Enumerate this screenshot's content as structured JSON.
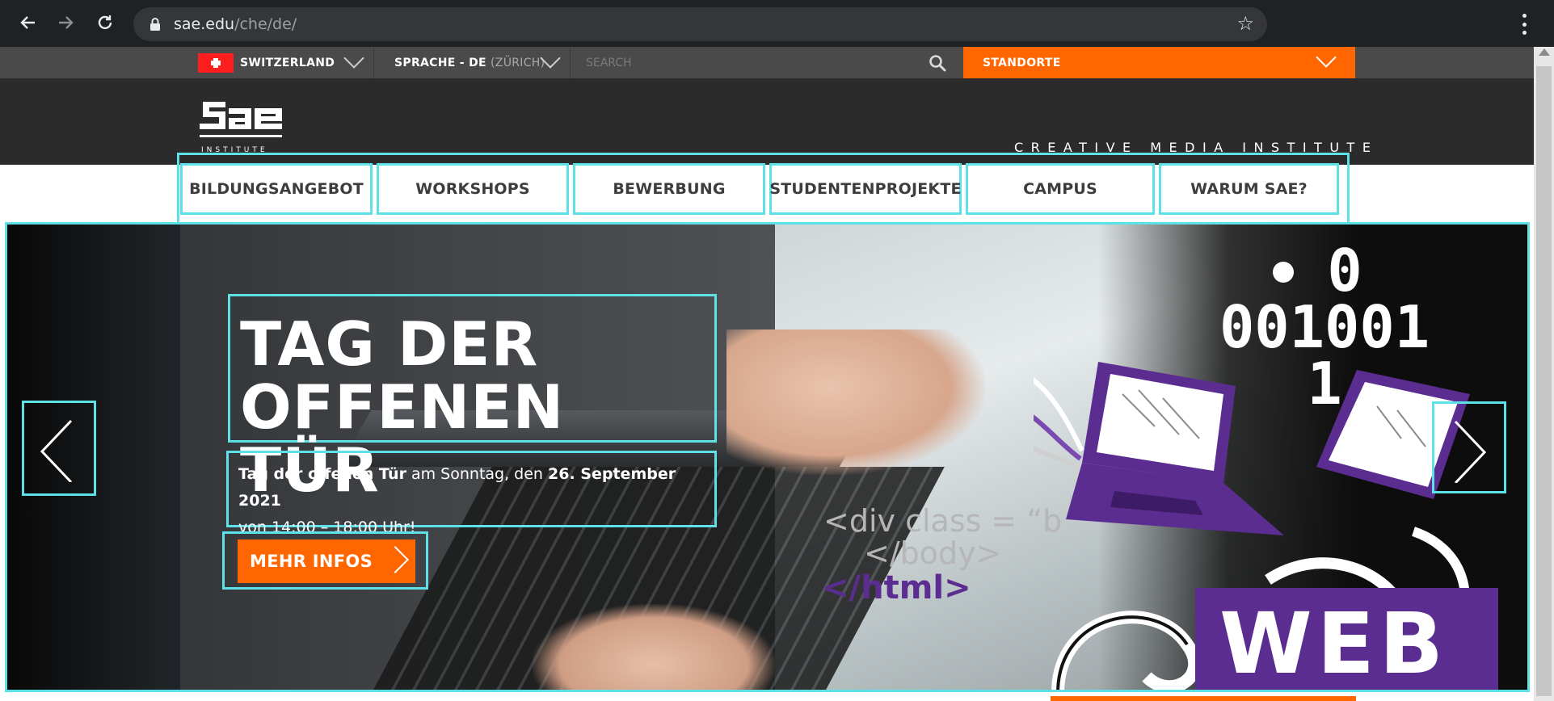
{
  "browser": {
    "url_domain": "sae.edu",
    "url_path": "/che/de/"
  },
  "topbar": {
    "country": "SWITZERLAND",
    "language_prefix": "SPRACHE - DE",
    "language_suffix": "(ZÜRICH)",
    "search_placeholder": "SEARCH",
    "standorte": "STANDORTE"
  },
  "header": {
    "logo_alt": "SAE INSTITUTE",
    "tagline": "CREATIVE MEDIA INSTITUTE"
  },
  "nav": {
    "items": [
      {
        "label": "BILDUNGSANGEBOT"
      },
      {
        "label": "WORKSHOPS"
      },
      {
        "label": "BEWERBUNG"
      },
      {
        "label": "STUDENTENPROJEKTE"
      },
      {
        "label": "CAMPUS"
      },
      {
        "label": "WARUM SAE?"
      }
    ]
  },
  "hero": {
    "title_line1": "TAG DER",
    "title_line2": "OFFENEN TÜR",
    "sub_bold1": "Tag der offenen Tür",
    "sub_mid": " am Sonntag, den ",
    "sub_bold2": "26. September 2021",
    "sub_line2": "von 14:00 – 18:00 Uhr!",
    "cta": "MEHR INFOS",
    "art_code_line1": "<div class = “b",
    "art_code_line2": "</body>",
    "art_code_line3": "</html>",
    "art_binary_line1": "0",
    "art_binary_line2": "001001",
    "art_binary_line3": "1",
    "art_badge": "WEB"
  },
  "colors": {
    "accent_orange": "#ff6600",
    "highlight_cyan": "#5de0e6",
    "brand_purple": "#5c2d91",
    "header_dark": "#2b2b2b",
    "topbar_gray": "#4a4a4a"
  },
  "icons": {
    "back": "arrow-left-icon",
    "forward": "arrow-right-icon",
    "reload": "reload-icon",
    "lock": "lock-icon",
    "bookmark": "star-icon",
    "menu": "kebab-menu-icon",
    "search": "search-icon",
    "flag": "swiss-flag-icon",
    "prev": "chevron-left-icon",
    "next": "chevron-right-icon"
  }
}
